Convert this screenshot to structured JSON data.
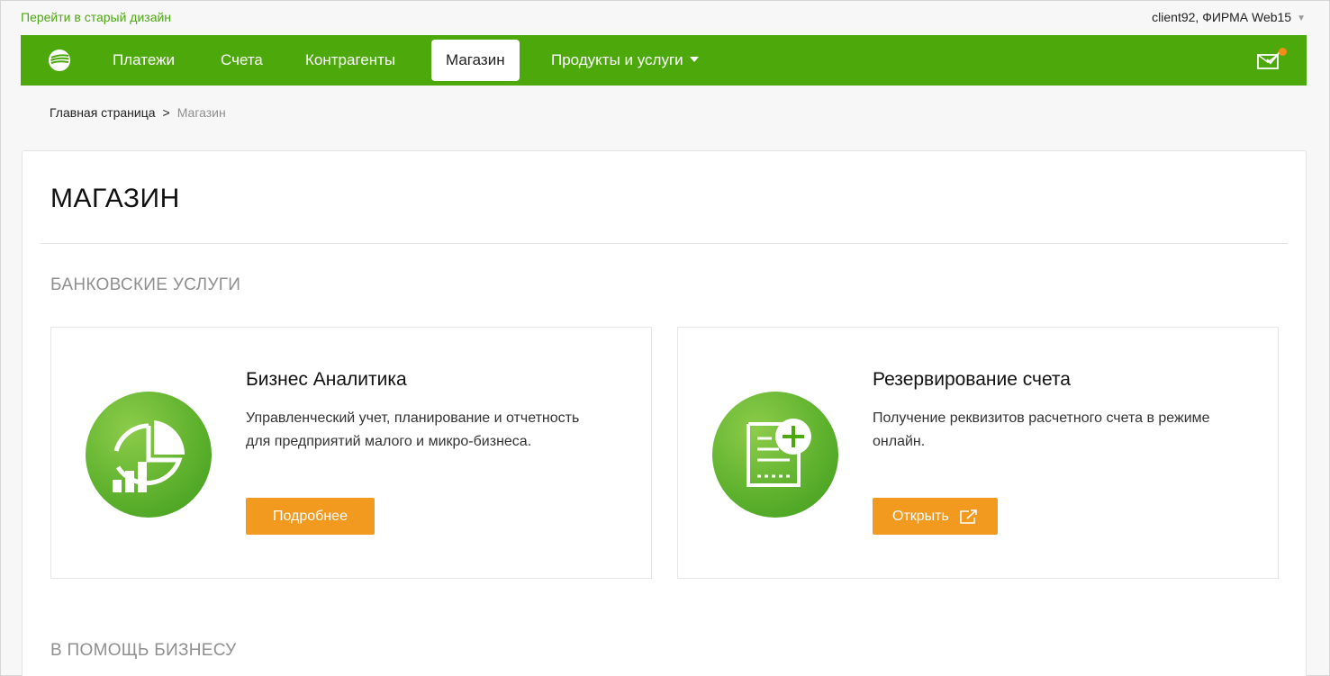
{
  "topbar": {
    "old_design_link": "Перейти в старый дизайн",
    "user": "client92, ФИРМА Web15"
  },
  "nav": {
    "items": [
      {
        "label": "Платежи"
      },
      {
        "label": "Счета"
      },
      {
        "label": "Контрагенты"
      },
      {
        "label": "Магазин",
        "active": true
      },
      {
        "label": "Продукты и услуги",
        "dropdown": true
      }
    ],
    "accent_color": "#4ca80b",
    "notification_color": "#f28c1b"
  },
  "breadcrumb": {
    "home": "Главная страница",
    "separator": ">",
    "current": "Магазин"
  },
  "page": {
    "title": "МАГАЗИН",
    "sections": [
      {
        "title": "БАНКОВСКИЕ УСЛУГИ",
        "cards": [
          {
            "title": "Бизнес Аналитика",
            "description": "Управленческий учет, планирование и отчетность для предприятий малого и микро-бизнеса.",
            "button": "Подробнее",
            "icon": "pie-chart-icon"
          },
          {
            "title": "Резервирование счета",
            "description": "Получение реквизитов расчетного счета в режиме онлайн.",
            "button": "Открыть",
            "icon": "document-plus-icon",
            "button_icon": "external-link-icon"
          }
        ]
      },
      {
        "title": "В ПОМОЩЬ БИЗНЕСУ"
      }
    ],
    "button_color": "#f29a1f"
  }
}
